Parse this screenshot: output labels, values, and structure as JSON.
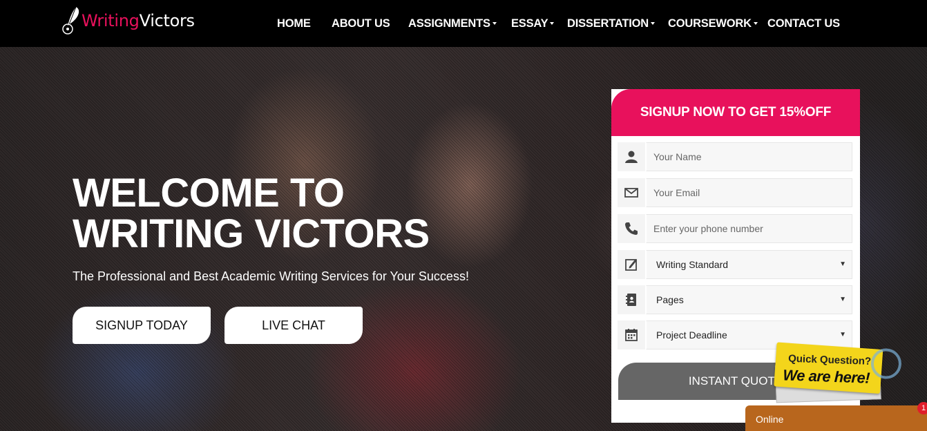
{
  "header": {
    "logo": {
      "word1": "Writing",
      "word2": "Victors"
    },
    "nav": [
      {
        "label": "HOME",
        "dropdown": false
      },
      {
        "label": "ABOUT US",
        "dropdown": false
      },
      {
        "label": "ASSIGNMENTS",
        "dropdown": true
      },
      {
        "label": "ESSAY",
        "dropdown": true
      },
      {
        "label": "DISSERTATION",
        "dropdown": true
      },
      {
        "label": "COURSEWORK",
        "dropdown": true
      },
      {
        "label": "CONTACT US",
        "dropdown": false
      }
    ]
  },
  "hero": {
    "title_line1": "WELCOME TO",
    "title_line2": "WRITING VICTORS",
    "subtitle": "The Professional and Best Academic Writing Services for Your Success!",
    "signup_button": "SIGNUP TODAY",
    "chat_button": "LIVE CHAT"
  },
  "form": {
    "heading": "SIGNUP NOW TO GET 15%OFF",
    "name_placeholder": "Your Name",
    "email_placeholder": "Your Email",
    "phone_placeholder": "Enter your phone number",
    "writing_standard": "Writing Standard",
    "pages": "Pages",
    "deadline": "Project Deadline",
    "submit": "INSTANT QUOTE"
  },
  "chat": {
    "badge_line1": "Quick Question?",
    "badge_line2": "We are here!",
    "status": "Online",
    "notification_count": "1"
  },
  "icons": {
    "logo": "quill-pen-icon",
    "name": "user-icon",
    "email": "envelope-icon",
    "phone": "phone-icon",
    "writing_standard": "edit-icon",
    "pages": "contact-book-icon",
    "deadline": "calendar-icon"
  },
  "colors": {
    "brand_pink": "#e8115c",
    "nav_bg": "#000000",
    "quote_button": "#666666",
    "online_bar": "#b8661d",
    "badge_yellow": "#f3d51b"
  }
}
